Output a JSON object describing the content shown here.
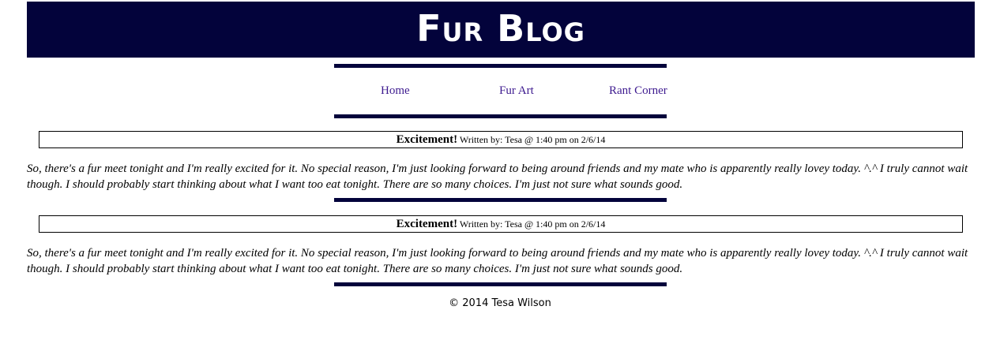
{
  "site": {
    "title": "Fur Blog",
    "header_color": "#03033b",
    "link_color": "#3d1a8f"
  },
  "nav": {
    "items": [
      {
        "label": "Home"
      },
      {
        "label": "Fur Art"
      },
      {
        "label": "Rant Corner"
      }
    ]
  },
  "posts": [
    {
      "title": "Excitement!",
      "byline": "Written by: Tesa @ 1:40 pm on 2/6/14",
      "body": "So, there's a fur meet tonight and I'm really excited for it. No special reason, I'm just looking forward to being around friends and my mate who is apparently really lovey today. ^.^ I truly cannot wait though. I should probably start thinking about what I want too eat tonight. There are so many choices. I'm just not sure what sounds good."
    },
    {
      "title": "Excitement!",
      "byline": "Written by: Tesa @ 1:40 pm on 2/6/14",
      "body": "So, there's a fur meet tonight and I'm really excited for it. No special reason, I'm just looking forward to being around friends and my mate who is apparently really lovey today. ^.^ I truly cannot wait though. I should probably start thinking about what I want too eat tonight. There are so many choices. I'm just not sure what sounds good."
    }
  ],
  "footer": {
    "copyright": "© 2014 Tesa Wilson"
  }
}
